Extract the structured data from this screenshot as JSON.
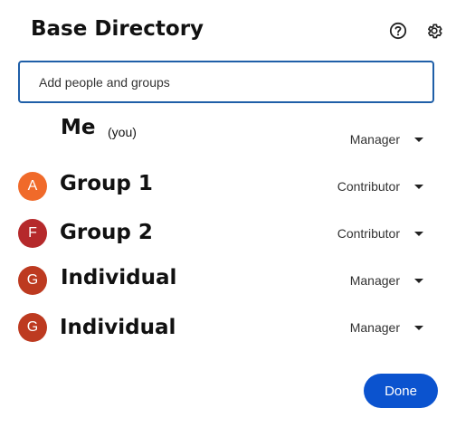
{
  "dialog": {
    "title": "Base Directory",
    "help_icon": "help-circle-icon",
    "settings_icon": "gear-icon"
  },
  "search": {
    "placeholder": "Add people and groups"
  },
  "members": [
    {
      "name": "Me",
      "suffix": "(you)",
      "avatar_letter": "",
      "avatar_color": "",
      "role": "Manager"
    },
    {
      "name": "Group 1",
      "suffix": "",
      "avatar_letter": "A",
      "avatar_color": "#f06a2a",
      "role": "Contributor"
    },
    {
      "name": "Group 2",
      "suffix": "",
      "avatar_letter": "F",
      "avatar_color": "#b5292b",
      "role": "Contributor"
    },
    {
      "name": "Individual",
      "suffix": "",
      "avatar_letter": "G",
      "avatar_color": "#bd3a20",
      "role": "Manager"
    },
    {
      "name": "Individual",
      "suffix": "",
      "avatar_letter": "G",
      "avatar_color": "#bd3a20",
      "role": "Manager"
    }
  ],
  "footer": {
    "done_label": "Done"
  },
  "colors": {
    "accent": "#0b53cf",
    "search_border": "#1f5fa8"
  }
}
